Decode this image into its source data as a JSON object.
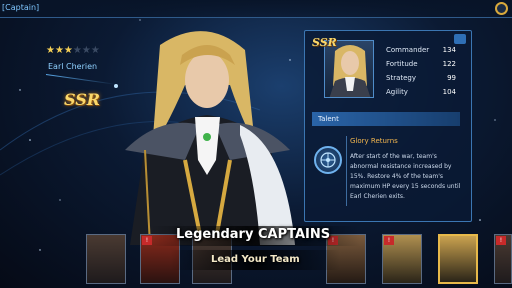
{
  "top_bar": {
    "tab_label": "[Captain]"
  },
  "character": {
    "stars_on": "★★★",
    "stars_off": "★★★",
    "name": "Earl Cherien",
    "rarity": "SSR"
  },
  "panel": {
    "rarity": "SSR",
    "stats": [
      {
        "label": "Commander",
        "value": "134"
      },
      {
        "label": "Fortitude",
        "value": "122"
      },
      {
        "label": "Strategy",
        "value": "99"
      },
      {
        "label": "Agility",
        "value": "104"
      }
    ],
    "talent_header": "Talent",
    "talent_name": "Glory Returns",
    "talent_desc": "After start of the war, team's abnormal resistance increased by 15%. Restore 4% of the team's maximum HP every 15 seconds until Earl Cherien exits."
  },
  "roster": {
    "badge": "!"
  },
  "banner": {
    "title": "Legendary CAPTAINS",
    "subtitle": "Lead Your Team"
  },
  "colors": {
    "accent": "#3b76b2",
    "gold": "#e7b94a",
    "talent_name": "#f2b64e"
  }
}
